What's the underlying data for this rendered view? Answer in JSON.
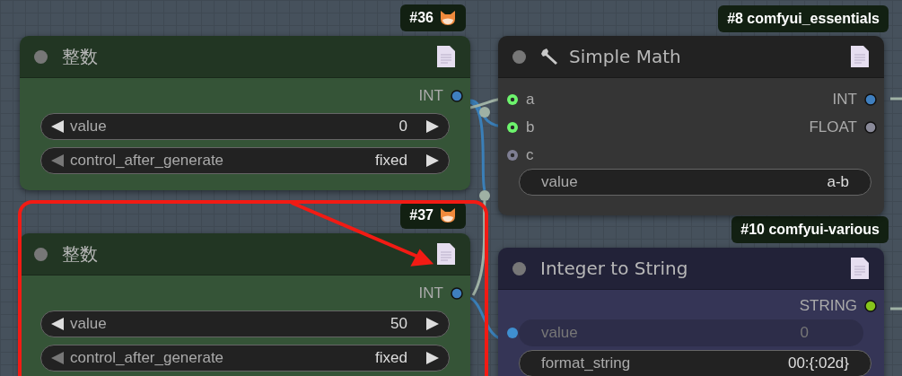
{
  "nodes": [
    {
      "badge": {
        "text": "#36",
        "fox": true
      },
      "title": "整数",
      "title_icon": false,
      "color": "#355437",
      "outputs": [
        {
          "name": "INT",
          "color": "#3f7fbf"
        }
      ],
      "widgets": [
        {
          "kind": "number",
          "label": "value",
          "value": "0",
          "prev_enabled": true
        },
        {
          "kind": "combo",
          "label": "control_after_generate",
          "value": "fixed",
          "prev_enabled": false
        }
      ]
    },
    {
      "badge": {
        "text": "#37",
        "fox": true
      },
      "title": "整数",
      "title_icon": false,
      "color": "#355437",
      "outputs": [
        {
          "name": "INT",
          "color": "#3f7fbf"
        }
      ],
      "widgets": [
        {
          "kind": "number",
          "label": "value",
          "value": "50",
          "prev_enabled": true
        },
        {
          "kind": "combo",
          "label": "control_after_generate",
          "value": "fixed",
          "prev_enabled": false
        }
      ]
    },
    {
      "badge": {
        "text": "#8 comfyui_essentials",
        "fox": false
      },
      "title": "Simple Math",
      "title_icon": true,
      "color": "#353535",
      "inputs": [
        {
          "name": "a",
          "color": "#6df46d"
        },
        {
          "name": "b",
          "color": "#6df46d"
        },
        {
          "name": "c",
          "color": "#7e7e92"
        }
      ],
      "outputs": [
        {
          "name": "INT",
          "color": "#3f7fbf"
        },
        {
          "name": "FLOAT",
          "color": "#8a8a99"
        }
      ],
      "widgets": [
        {
          "kind": "text",
          "label": "value",
          "value": "a-b"
        }
      ]
    },
    {
      "badge": {
        "text": "#10 comfyui-various",
        "fox": false
      },
      "title": "Integer to String",
      "title_icon": false,
      "color": "#353556",
      "outputs": [
        {
          "name": "STRING",
          "color": "#86c41c"
        }
      ],
      "widgets": [
        {
          "kind": "linked",
          "label": "value",
          "value": "0",
          "color": "#3f8fd0"
        },
        {
          "kind": "text",
          "label": "format_string",
          "value": "00:{:02d}"
        }
      ]
    }
  ]
}
